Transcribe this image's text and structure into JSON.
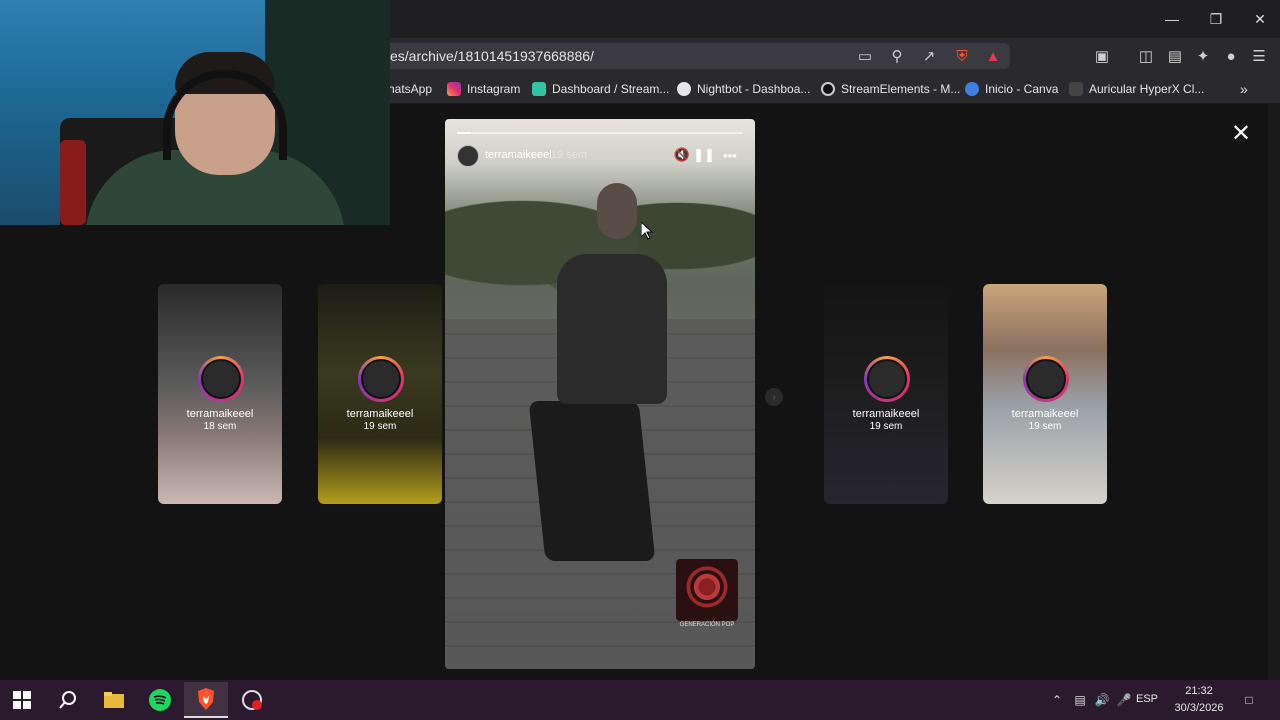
{
  "browser": {
    "url": "es/archive/18101451937668886/",
    "bookmarks": [
      {
        "label": "hatsApp",
        "icon": "whatsapp-icon",
        "color": "#25d366"
      },
      {
        "label": "Instagram",
        "icon": "instagram-icon",
        "color": "#e1306c"
      },
      {
        "label": "Dashboard / Stream...",
        "icon": "streamlabs-icon",
        "color": "#31c3a2"
      },
      {
        "label": "Nightbot - Dashboa...",
        "icon": "nightbot-icon",
        "color": "#dddddd"
      },
      {
        "label": "StreamElements - M...",
        "icon": "streamelements-icon",
        "color": "#cccccc"
      },
      {
        "label": "Inicio - Canva",
        "icon": "canva-icon",
        "color": "#3f7fe0"
      },
      {
        "label": "Auricular HyperX Cl...",
        "icon": "hyperx-icon",
        "color": "#555555"
      }
    ]
  },
  "story": {
    "username": "terramaikeeel",
    "time": "19 sem",
    "progress": 0.05,
    "music_label": "GENERACIÓN POP"
  },
  "previews": [
    {
      "username": "terramaikeeel",
      "time": "18 sem"
    },
    {
      "username": "terramaikeeel",
      "time": "19 sem"
    },
    {
      "username": "terramaikeeel",
      "time": "19 sem"
    },
    {
      "username": "terramaikeeel",
      "time": "19 sem"
    }
  ],
  "taskbar": {
    "language": "ESP",
    "time": "21:32",
    "date": "30/3/2026"
  }
}
